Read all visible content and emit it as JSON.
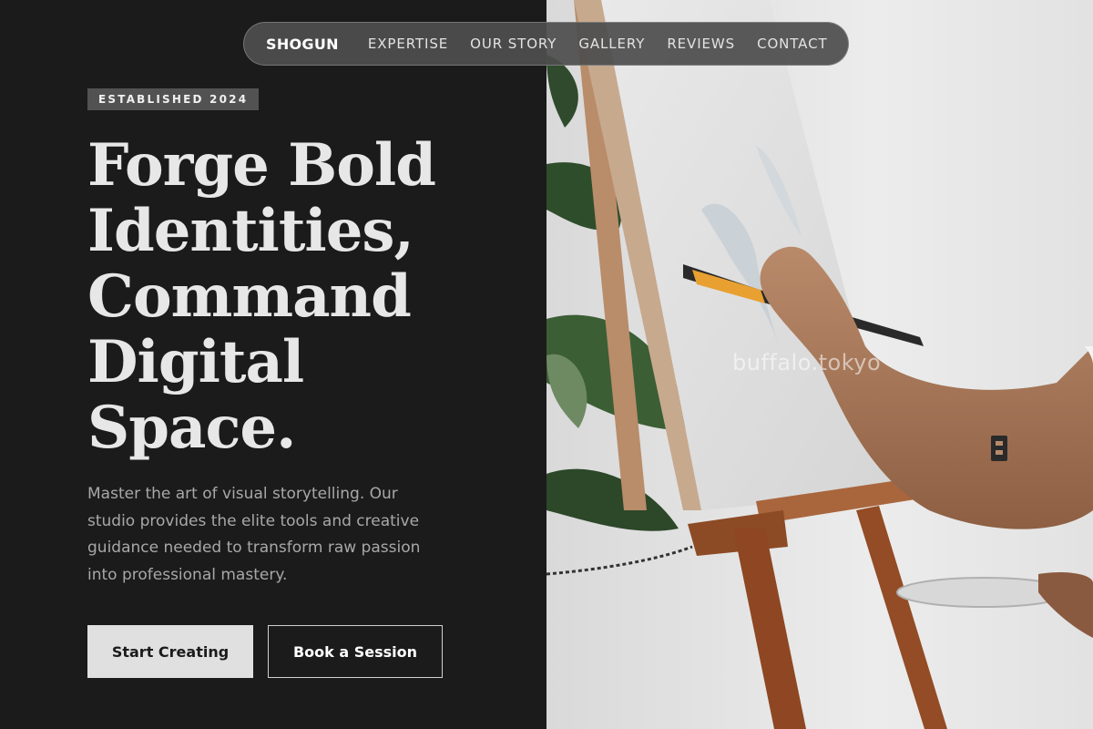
{
  "nav": {
    "brand": "SHOGUN",
    "links": [
      "EXPERTISE",
      "OUR STORY",
      "GALLERY",
      "REVIEWS",
      "CONTACT"
    ]
  },
  "hero": {
    "badge": "ESTABLISHED 2024",
    "headline_lines": [
      "Forge Bold",
      "Identities,",
      "Command",
      "Digital",
      "Space."
    ],
    "description": "Master the art of visual storytelling. Our studio provides the elite tools and creative guidance needed to transform raw passion into professional mastery.",
    "primary_cta": "Start Creating",
    "secondary_cta": "Book a Session"
  },
  "image": {
    "subject": "hand painting on canvas at easel",
    "watermark": "buffalo.tokyo"
  },
  "colors": {
    "background": "#1b1b1b",
    "headline": "#e7e7e7",
    "body_text": "#a8a8a8",
    "badge_bg": "#525252",
    "primary_button_bg": "#e0e0e0",
    "nav_bg": "#4e4e4e"
  }
}
